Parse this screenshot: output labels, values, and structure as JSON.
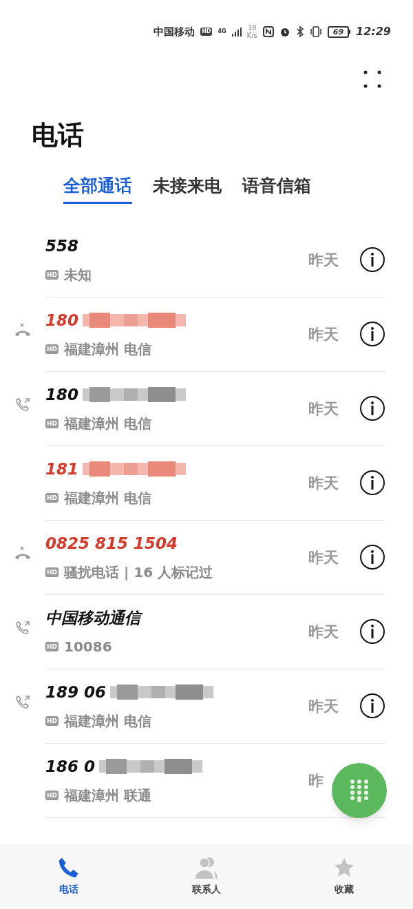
{
  "status_bar": {
    "carrier": "中国移动",
    "hd": "HD",
    "network": "4G",
    "speed_value": "38",
    "speed_unit": "K/s",
    "battery": "69",
    "time": "12:29"
  },
  "title": "电话",
  "tabs": [
    {
      "label": "全部通话",
      "selected": true
    },
    {
      "label": "未接来电",
      "selected": false
    },
    {
      "label": "语音信箱",
      "selected": false
    }
  ],
  "calls": [
    {
      "kind": "none",
      "missed": false,
      "number": "558",
      "redacted": false,
      "hd": "HD",
      "location": "未知",
      "time": "昨天",
      "info": true
    },
    {
      "kind": "missed",
      "missed": true,
      "number": "180",
      "redacted": true,
      "hd": "HD",
      "location": "福建漳州 电信",
      "time": "昨天",
      "info": true
    },
    {
      "kind": "outgoing",
      "missed": false,
      "number": "180",
      "redacted": true,
      "hd": "HD",
      "location": "福建漳州 电信",
      "time": "昨天",
      "info": true
    },
    {
      "kind": "none",
      "missed": true,
      "number": "181",
      "redacted": true,
      "hd": "HD",
      "location": "福建漳州 电信",
      "time": "昨天",
      "info": true
    },
    {
      "kind": "missed",
      "missed": true,
      "number": "0825 815 1504",
      "redacted": false,
      "hd": "HD",
      "location": "骚扰电话 | 16 人标记过",
      "time": "昨天",
      "info": true
    },
    {
      "kind": "outgoing",
      "missed": false,
      "number": "中国移动通信",
      "redacted": false,
      "hd": "HD",
      "location": "10086",
      "time": "昨天",
      "info": true
    },
    {
      "kind": "outgoing",
      "missed": false,
      "number": "189 06",
      "redacted": true,
      "hd": "HD",
      "location": "福建漳州 电信",
      "time": "昨天",
      "info": true
    },
    {
      "kind": "none",
      "missed": false,
      "number": "186 0",
      "redacted": true,
      "hd": "HD",
      "location": "福建漳州 联通",
      "time": "昨",
      "info": false
    }
  ],
  "nav": [
    {
      "label": "电话",
      "kind": "phone",
      "selected": true
    },
    {
      "label": "联系人",
      "kind": "contacts",
      "selected": false
    },
    {
      "label": "收藏",
      "kind": "star",
      "selected": false
    }
  ]
}
